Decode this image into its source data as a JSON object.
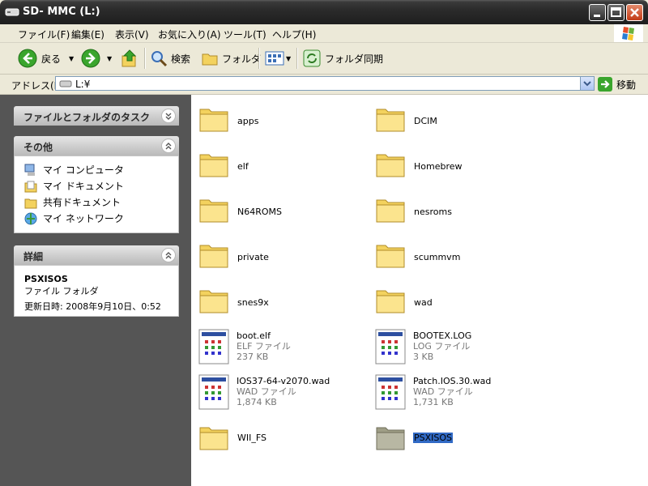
{
  "window": {
    "title": "SD- MMC (L:)"
  },
  "menu": [
    "ファイル(F)",
    "編集(E)",
    "表示(V)",
    "お気に入り(A)",
    "ツール(T)",
    "ヘルプ(H)"
  ],
  "toolbar": {
    "back": "戻る",
    "search": "検索",
    "folders": "フォルダ",
    "sync": "フォルダ同期"
  },
  "address": {
    "label": "アドレス(D)",
    "value": "L:¥",
    "go": "移動"
  },
  "left": {
    "tasks_title": "ファイルとフォルダのタスク",
    "other_title": "その他",
    "other_links": [
      "マイ コンピュータ",
      "マイ ドキュメント",
      "共有ドキュメント",
      "マイ ネットワーク"
    ],
    "details_title": "詳細",
    "details": {
      "name": "PSXISOS",
      "type": "ファイル フォルダ",
      "modified": "更新日時: 2008年9月10日、0:52"
    }
  },
  "items": [
    {
      "name": "apps",
      "kind": "folder"
    },
    {
      "name": "DCIM",
      "kind": "folder"
    },
    {
      "name": "elf",
      "kind": "folder"
    },
    {
      "name": "Homebrew",
      "kind": "folder"
    },
    {
      "name": "N64ROMS",
      "kind": "folder"
    },
    {
      "name": "nesroms",
      "kind": "folder"
    },
    {
      "name": "private",
      "kind": "folder"
    },
    {
      "name": "scummvm",
      "kind": "folder"
    },
    {
      "name": "snes9x",
      "kind": "folder"
    },
    {
      "name": "wad",
      "kind": "folder"
    },
    {
      "name": "boot.elf",
      "kind": "file",
      "type": "ELF ファイル",
      "size": "237 KB"
    },
    {
      "name": "BOOTEX.LOG",
      "kind": "file",
      "type": "LOG ファイル",
      "size": "3 KB"
    },
    {
      "name": "IOS37-64-v2070.wad",
      "kind": "file",
      "type": "WAD ファイル",
      "size": "1,874 KB"
    },
    {
      "name": "Patch.IOS.30.wad",
      "kind": "file",
      "type": "WAD ファイル",
      "size": "1,731 KB"
    },
    {
      "name": "WII_FS",
      "kind": "folder"
    },
    {
      "name": "PSXISOS",
      "kind": "folder",
      "selected": true
    }
  ],
  "colors": {
    "selection": "#316ac5",
    "left_pane": "#555555",
    "folder": "#f6d86a"
  }
}
